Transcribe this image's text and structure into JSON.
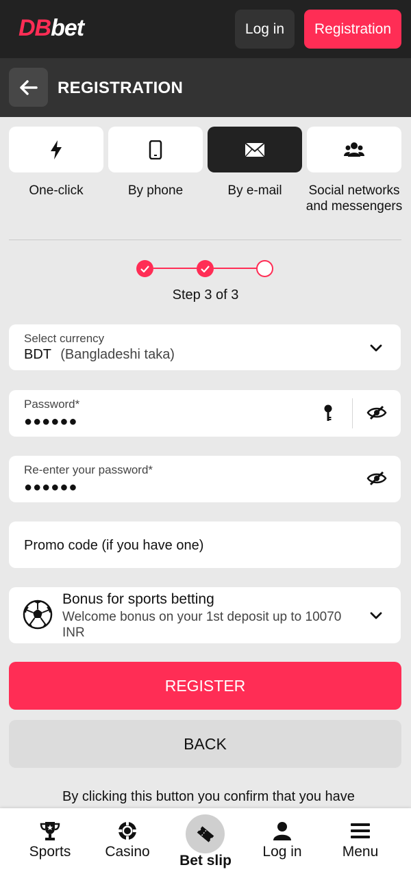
{
  "header": {
    "logo_part1": "DB",
    "logo_part2": "bet",
    "login_label": "Log in",
    "registration_label": "Registration"
  },
  "page": {
    "title": "REGISTRATION"
  },
  "methods": [
    {
      "label": "One-click",
      "icon": "lightning-icon",
      "active": false
    },
    {
      "label": "By phone",
      "icon": "phone-icon",
      "active": false
    },
    {
      "label": "By e-mail",
      "icon": "envelope-icon",
      "active": true
    },
    {
      "label": "Social networks and messengers",
      "icon": "users-icon",
      "active": false
    }
  ],
  "steps": {
    "text": "Step 3 of 3",
    "current": 3,
    "total": 3
  },
  "form": {
    "currency": {
      "label": "Select currency",
      "code": "BDT",
      "name": "(Bangladeshi taka)"
    },
    "password": {
      "label": "Password*",
      "value": "●●●●●●"
    },
    "repassword": {
      "label": "Re-enter your password*",
      "value": "●●●●●●"
    },
    "promo": {
      "placeholder": "Promo code (if you have one)"
    },
    "bonus": {
      "title": "Bonus for sports betting",
      "subtitle": "Welcome bonus on your 1st deposit up to 10070 INR"
    }
  },
  "actions": {
    "register_label": "REGISTER",
    "back_label": "BACK",
    "terms_text": "By clicking this button you confirm that you have"
  },
  "bottom_nav": {
    "sports": "Sports",
    "casino": "Casino",
    "betslip": "Bet slip",
    "login": "Log in",
    "menu": "Menu"
  },
  "colors": {
    "accent": "#ff2d55",
    "dark": "#222222",
    "header": "#333333",
    "background": "#e9e9e9"
  }
}
